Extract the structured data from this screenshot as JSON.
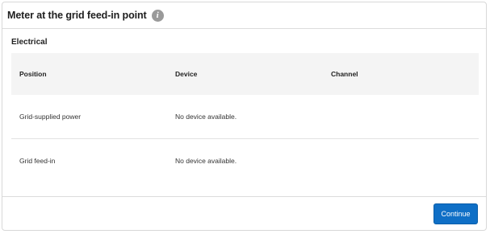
{
  "header": {
    "title": "Meter at the grid feed-in point",
    "info_icon": "info-icon",
    "info_glyph": "i"
  },
  "section": {
    "title": "Electrical"
  },
  "table": {
    "columns": [
      "Position",
      "Device",
      "Channel"
    ],
    "rows": [
      {
        "position": "Grid-supplied power",
        "device": "No device available.",
        "channel": ""
      },
      {
        "position": "Grid feed-in",
        "device": "No device available.",
        "channel": ""
      }
    ]
  },
  "footer": {
    "continue_label": "Continue"
  },
  "colors": {
    "accent": "#0f6fc6",
    "header_bg": "#f4f4f4",
    "icon_gray": "#9a9a9a"
  }
}
